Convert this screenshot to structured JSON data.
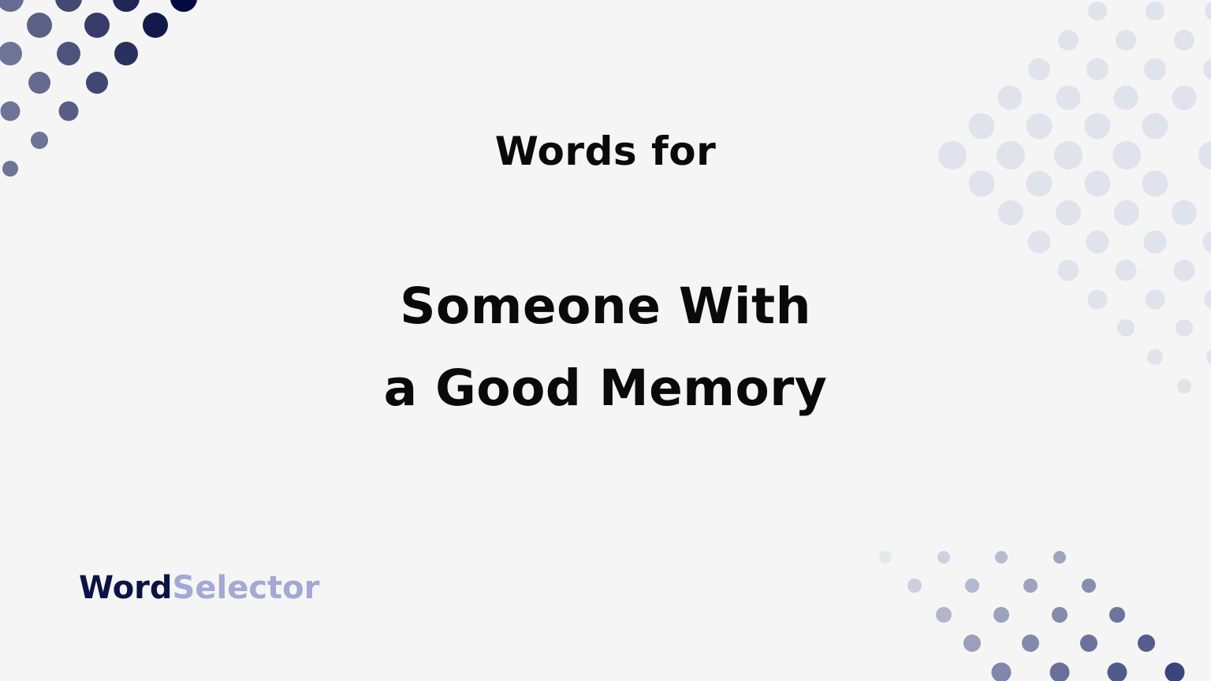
{
  "banner": {
    "subtitle": "Words for",
    "title_lines": [
      "Someone With",
      "a Good Memory"
    ]
  },
  "logo": {
    "part1": "Word",
    "part2": "Selector",
    "colors": {
      "part1": "#0c1445",
      "part2": "#a3a8d4"
    }
  },
  "decoration": {
    "background": "#f5f5f5",
    "dot_patterns": [
      {
        "name": "top-left",
        "style": "navy gradient",
        "colors": [
          "#6a7194",
          "#020a3f"
        ]
      },
      {
        "name": "top-right",
        "style": "light lavender",
        "colors": [
          "#e0e2ec"
        ]
      },
      {
        "name": "bottom-right",
        "style": "grey to navy gradient",
        "colors": [
          "#ececf0",
          "#3a4576"
        ]
      }
    ]
  }
}
